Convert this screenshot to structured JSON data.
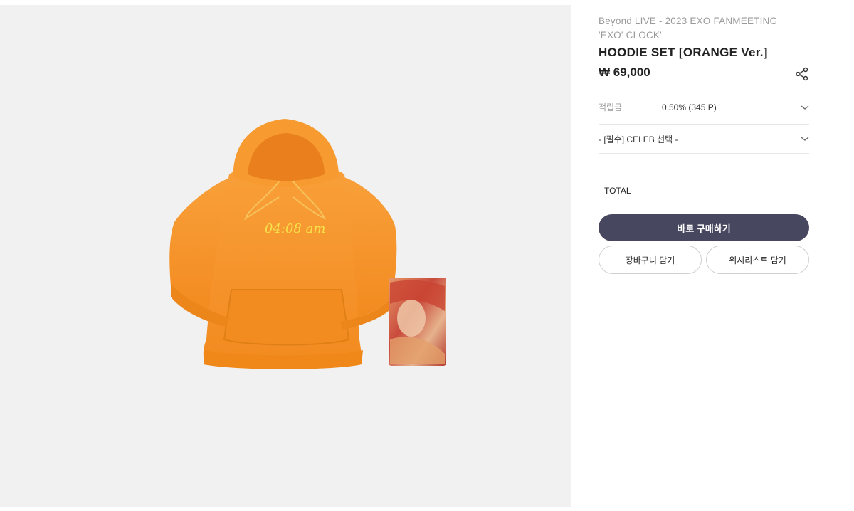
{
  "product": {
    "event_line1": "Beyond LIVE - 2023 EXO FANMEETING",
    "event_line2": "'EXO' CLOCK'",
    "title": "HOODIE SET [ORANGE Ver.]",
    "price": "₩ 69,000",
    "share_icon": "share-icon",
    "image_text": "04:08 am"
  },
  "options": {
    "points_label": "적립금",
    "points_value": "0.50% (345 P)",
    "celeb_select": "- [필수] CELEB 선택 -"
  },
  "total_label": "TOTAL",
  "actions": {
    "buy_now": "바로 구매하기",
    "add_to_cart": "장바구니 담기",
    "add_to_wishlist": "위시리스트 담기"
  },
  "colors": {
    "primary_button": "#474760",
    "hoodie": "#f7922a",
    "embroidery": "#f6e24a"
  }
}
